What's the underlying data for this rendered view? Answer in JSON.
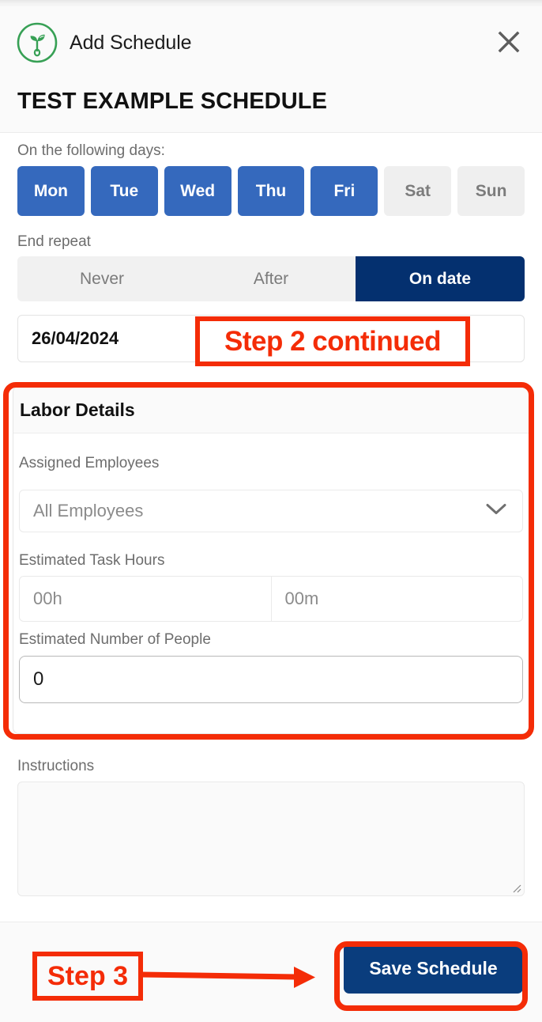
{
  "header": {
    "logo_icon": "seedling-icon",
    "title": "Add Schedule",
    "close_icon": "close-icon",
    "accent_green": "#37a055"
  },
  "document_title": "TEST EXAMPLE SCHEDULE",
  "repeat": {
    "days_label": "On the following days:",
    "days": [
      {
        "label": "Mon",
        "selected": true
      },
      {
        "label": "Tue",
        "selected": true
      },
      {
        "label": "Wed",
        "selected": true
      },
      {
        "label": "Thu",
        "selected": true
      },
      {
        "label": "Fri",
        "selected": true
      },
      {
        "label": "Sat",
        "selected": false
      },
      {
        "label": "Sun",
        "selected": false
      }
    ],
    "end_repeat_label": "End repeat",
    "end_repeat_options": [
      {
        "label": "Never",
        "selected": false
      },
      {
        "label": "After",
        "selected": false
      },
      {
        "label": "On date",
        "selected": true
      }
    ],
    "end_date_value": "26/04/2024"
  },
  "labor": {
    "section_title": "Labor Details",
    "assigned_employees_label": "Assigned Employees",
    "assigned_employees_value": "All Employees",
    "assigned_employees_chevron": "chevron-down-icon",
    "estimated_task_hours_label": "Estimated Task Hours",
    "hours_placeholder": "00h",
    "minutes_placeholder": "00m",
    "estimated_people_label": "Estimated Number of People",
    "estimated_people_value": "0"
  },
  "instructions": {
    "label": "Instructions",
    "value": "",
    "resize_icon": "resize-grip-icon"
  },
  "footer": {
    "save_label": "Save Schedule"
  },
  "annotations": {
    "step2": "Step 2 continued",
    "step3": "Step 3",
    "color": "#f42c07",
    "arrow_icon": "arrow-right-icon"
  },
  "colors": {
    "day_selected": "#3569bd",
    "day_unselected": "#efefef",
    "segment_active": "#04306f",
    "save_button": "#0a3d7d",
    "annotation_red": "#f42c07",
    "logo_green": "#37a055"
  }
}
